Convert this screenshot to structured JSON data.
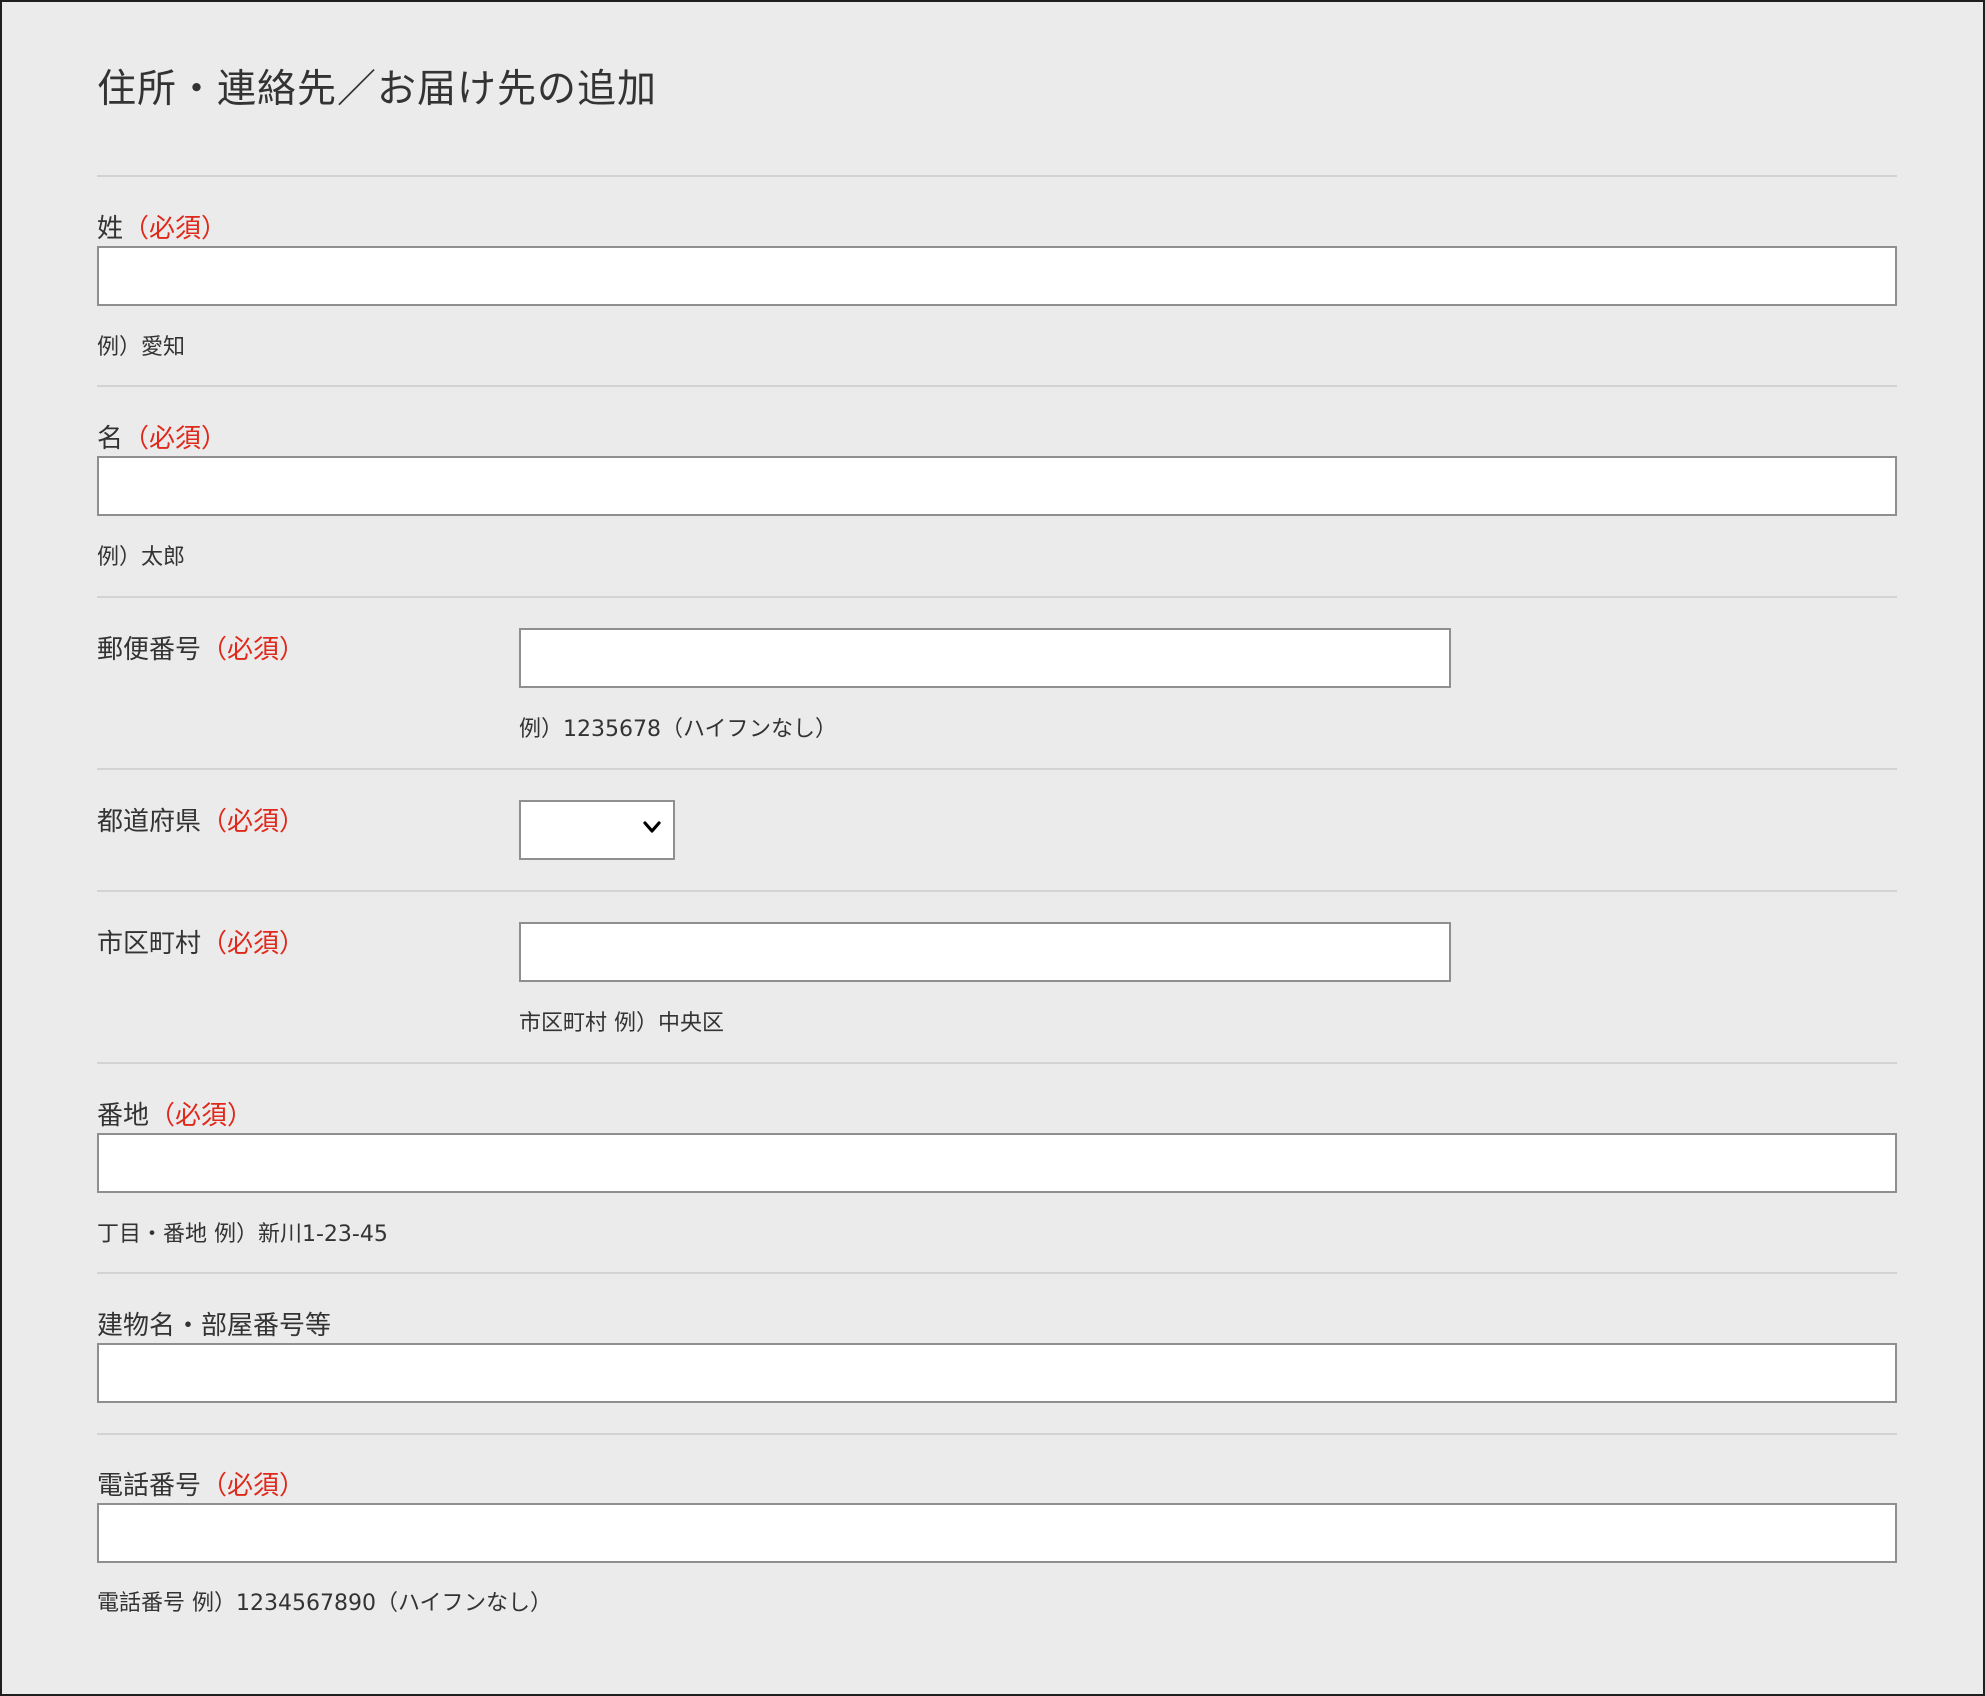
{
  "page": {
    "title": "住所・連絡先／お届け先の追加"
  },
  "fields": {
    "last_name": {
      "label": "姓",
      "required": "（必須）",
      "value": "",
      "hint": "例）愛知"
    },
    "first_name": {
      "label": "名",
      "required": "（必須）",
      "value": "",
      "hint": "例）太郎"
    },
    "postal_code": {
      "label": "郵便番号",
      "required": "（必須）",
      "value": "",
      "hint": "例）1235678（ハイフンなし）"
    },
    "prefecture": {
      "label": "都道府県",
      "required": "（必須）",
      "selected": "",
      "icon": "chevron-down-icon"
    },
    "city": {
      "label": "市区町村",
      "required": "（必須）",
      "value": "",
      "hint": "市区町村 例）中央区"
    },
    "street": {
      "label": "番地",
      "required": "（必須）",
      "value": "",
      "hint": "丁目・番地 例）新川1-23-45"
    },
    "building": {
      "label": "建物名・部屋番号等",
      "value": ""
    },
    "phone": {
      "label": "電話番号",
      "required": "（必須）",
      "value": "",
      "hint": "電話番号 例）1234567890（ハイフンなし）"
    }
  },
  "colors": {
    "background": "#ebebeb",
    "required": "#e0281b",
    "text": "#333333",
    "divider": "#d3d3d3",
    "input_border": "#8f8f8f"
  }
}
